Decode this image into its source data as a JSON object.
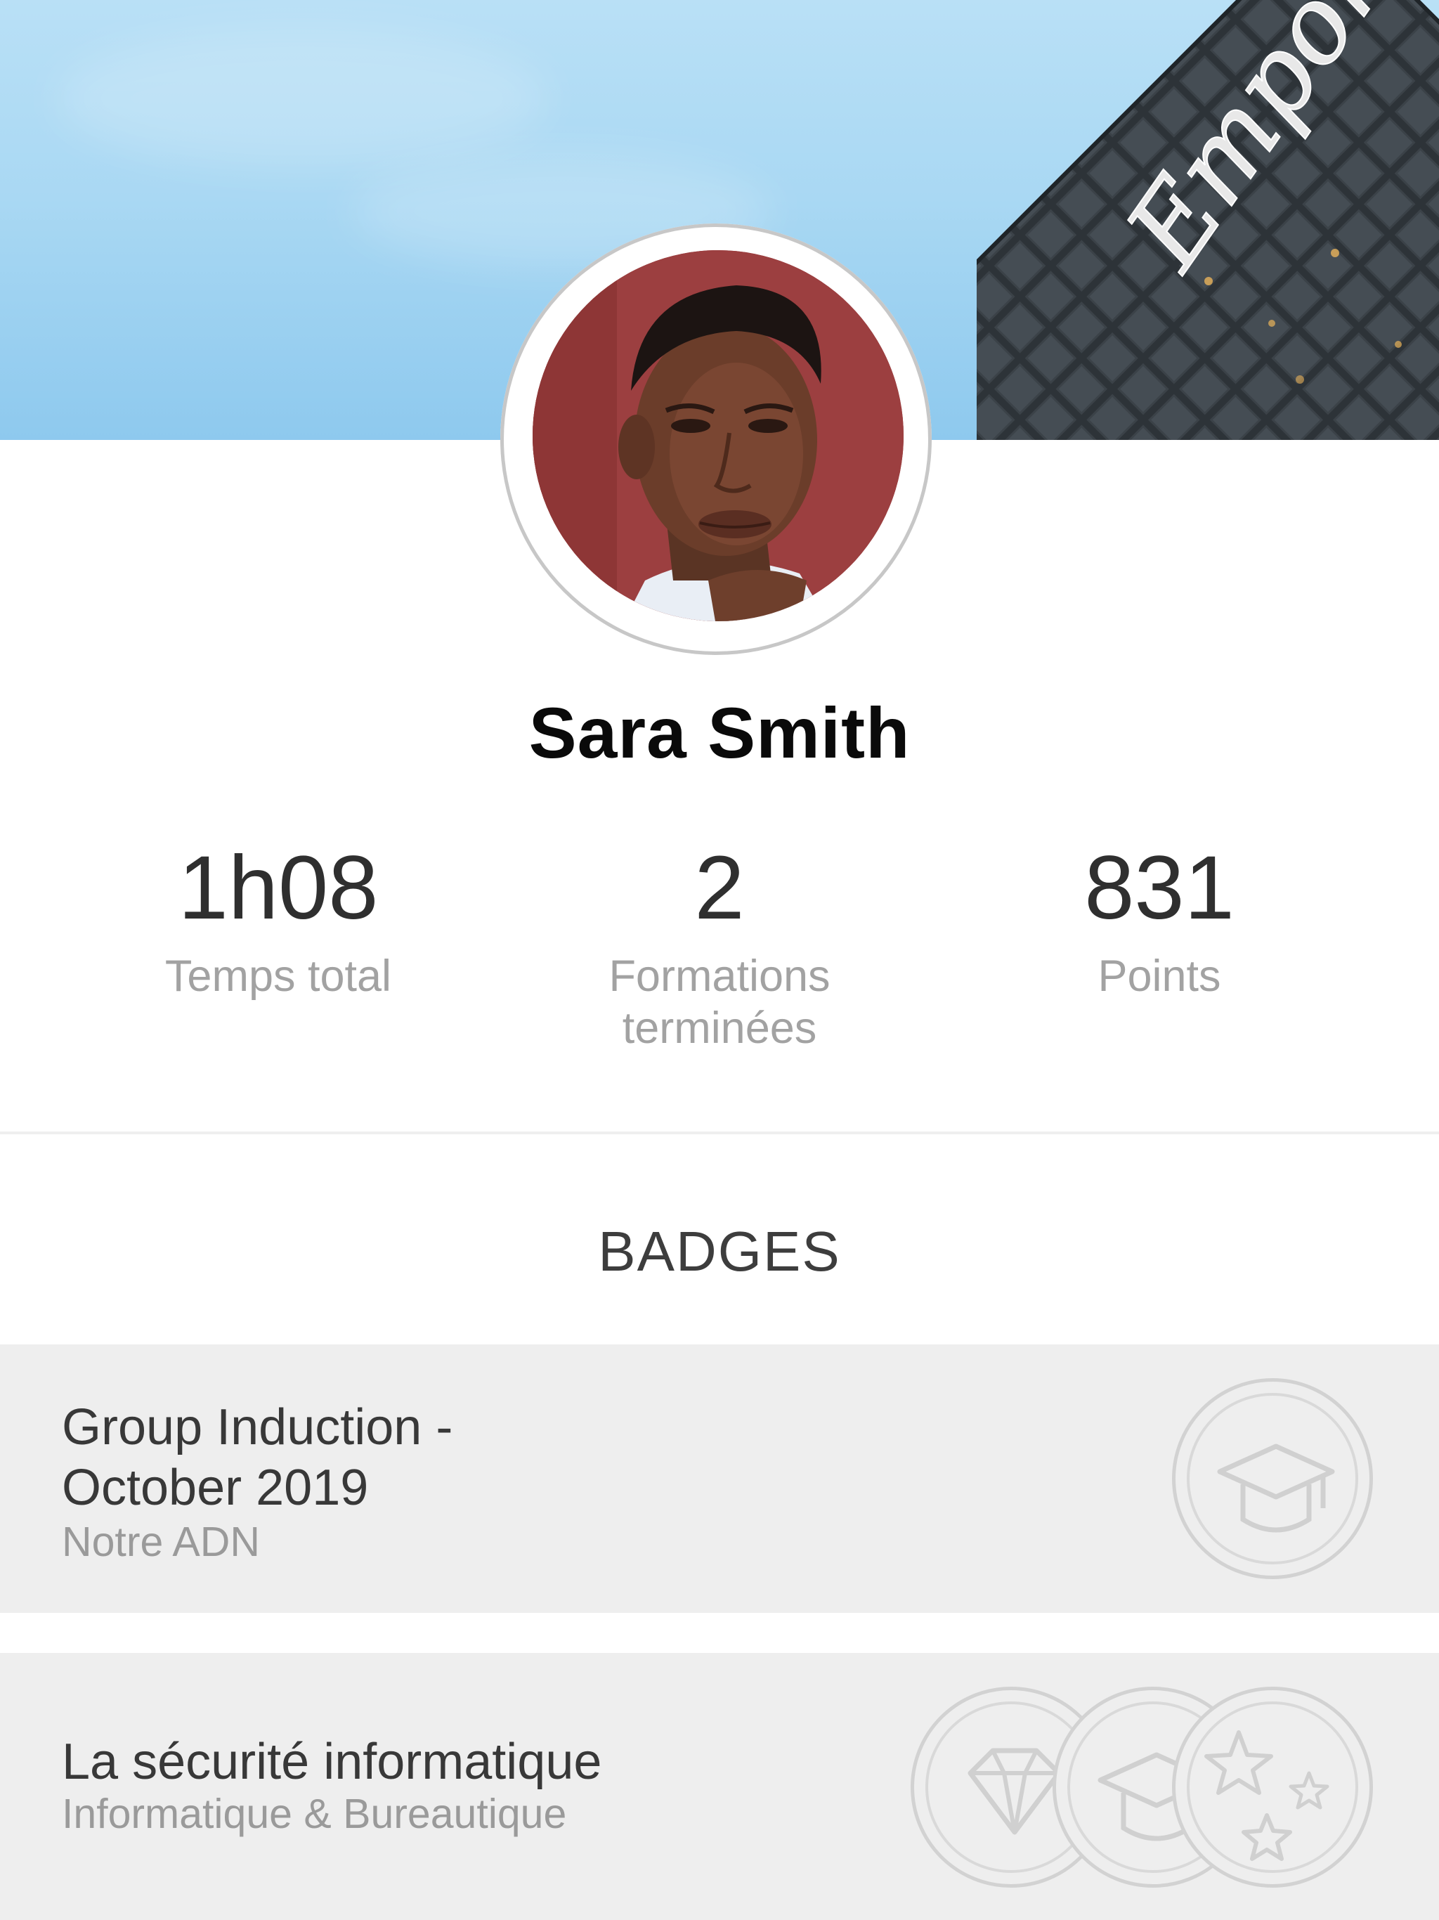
{
  "profile": {
    "name": "Sara Smith",
    "building_sign": "Empora"
  },
  "stats": [
    {
      "value": "1h08",
      "label": "Temps total"
    },
    {
      "value": "2",
      "label": "Formations\nterminées"
    },
    {
      "value": "831",
      "label": "Points"
    }
  ],
  "badges": {
    "section_title": "BADGES",
    "items": [
      {
        "title_line1": "Group Induction -",
        "title_line2": "October 2019",
        "subtitle": "Notre ADN",
        "icons": [
          "graduation-cap-icon"
        ]
      },
      {
        "title_line1": "La sécurité informatique",
        "subtitle": "Informatique & Bureautique",
        "icons": [
          "diamond-icon",
          "graduation-cap-icon",
          "stars-icon"
        ]
      }
    ]
  },
  "colors": {
    "banner_sky": "#a9d8f3",
    "badge_row_bg": "#eeeeee",
    "name_text": "#0a0a0a",
    "stat_value": "#2f2f2f",
    "stat_label": "#a2a2a2"
  }
}
